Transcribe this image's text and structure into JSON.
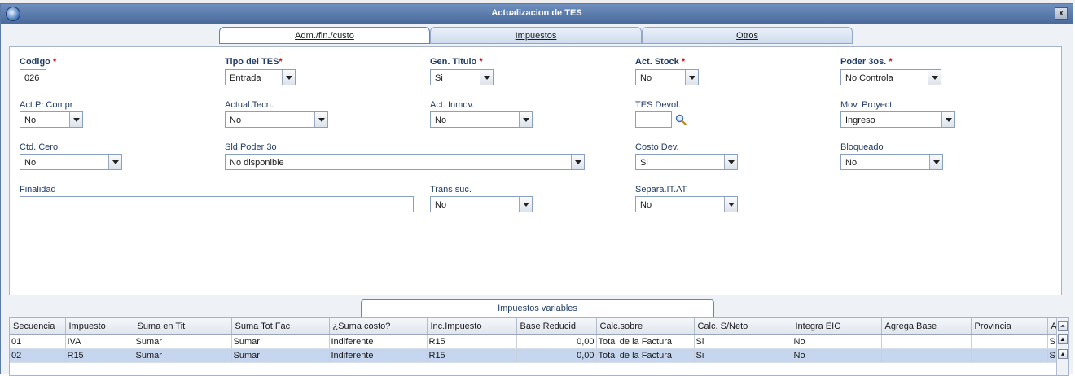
{
  "window": {
    "title": "Actualizacion de TES",
    "close_label": "x"
  },
  "tabs": [
    {
      "label": "Adm./fin./custo",
      "active": true
    },
    {
      "label": "Impuestos",
      "active": false
    },
    {
      "label": "Otros",
      "active": false
    }
  ],
  "form": {
    "codigo": {
      "label": "Codigo",
      "required_mark": "*",
      "value": "026"
    },
    "tipo_tes": {
      "label": "Tipo del TES",
      "required_mark": "*",
      "value": "Entrada"
    },
    "gen_titulo": {
      "label": "Gen. Titulo",
      "required_mark": "*",
      "value": "Si"
    },
    "act_stock": {
      "label": "Act. Stock",
      "required_mark": "*",
      "value": "No"
    },
    "poder_3os": {
      "label": "Poder 3os.",
      "required_mark": "*",
      "value": "No Controla"
    },
    "act_pr_compr": {
      "label": "Act.Pr.Compr",
      "value": "No"
    },
    "actual_tecn": {
      "label": "Actual.Tecn.",
      "value": "No"
    },
    "act_inmov": {
      "label": "Act. Inmov.",
      "value": "No"
    },
    "tes_devol": {
      "label": "TES Devol.",
      "value": ""
    },
    "mov_proyect": {
      "label": "Mov. Proyect",
      "value": "Ingreso"
    },
    "ctd_cero": {
      "label": "Ctd. Cero",
      "value": "No"
    },
    "sld_poder_3o": {
      "label": "Sld.Poder 3o",
      "value": "No disponible"
    },
    "costo_dev": {
      "label": "Costo Dev.",
      "value": "Si"
    },
    "bloqueado": {
      "label": "Bloqueado",
      "value": "No"
    },
    "finalidad": {
      "label": "Finalidad",
      "value": ""
    },
    "trans_suc": {
      "label": "Trans suc.",
      "value": "No"
    },
    "separa_itat": {
      "label": "Separa.IT.AT",
      "value": "No"
    }
  },
  "subtab": {
    "label": "Impuestos variables"
  },
  "grid": {
    "columns": [
      "Secuencia",
      "Impuesto",
      "Suma en Titl",
      "Suma Tot Fac",
      "¿Suma costo?",
      "Inc.Impuesto",
      "Base Reducid",
      "Calc.sobre",
      "Calc. S/Neto",
      "Integra EIC",
      "Agrega Base",
      "Provincia",
      "A"
    ],
    "rows": [
      [
        "01",
        "IVA",
        "Sumar",
        "Sumar",
        "Indiferente",
        "R15",
        "0,00",
        "Total de la Factura",
        "Si",
        "No",
        "",
        "",
        "S"
      ],
      [
        "02",
        "R15",
        "Sumar",
        "Sumar",
        "Indiferente",
        "R15",
        "0,00",
        "Total de la Factura",
        "Si",
        "No",
        "",
        "",
        "S"
      ]
    ]
  },
  "icons": {
    "lookup": "magnifier-icon",
    "app": "app-logo-icon"
  }
}
